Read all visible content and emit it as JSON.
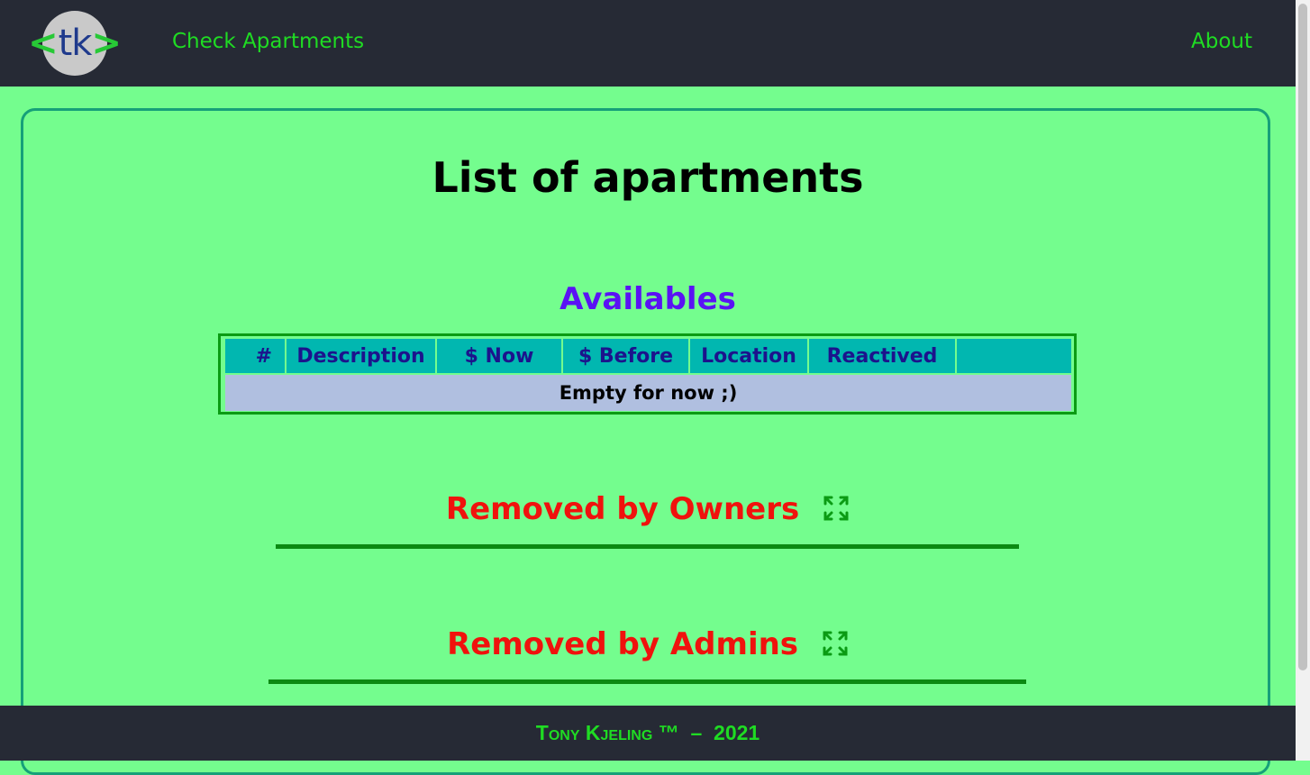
{
  "header": {
    "logo_text_open": "<",
    "logo_text": "tk",
    "logo_text_close": ">",
    "nav_check": "Check Apartments",
    "nav_about": "About"
  },
  "main": {
    "title": "List of apartments",
    "availables": {
      "title": "Availables",
      "columns": [
        "#",
        "Description",
        "$ Now",
        "$ Before",
        "Location",
        "Reactived",
        ""
      ],
      "empty_message": "Empty for now ;)"
    },
    "removed_owners": {
      "title": "Removed by Owners",
      "icon": "expand-icon"
    },
    "removed_admins": {
      "title": "Removed by Admins",
      "icon": "expand-icon"
    }
  },
  "footer": {
    "author": "Tony Kjeling",
    "trademark": "™",
    "separator": "–",
    "year": "2021"
  },
  "colors": {
    "page_bg": "#74fd8e",
    "header_bg": "#262a35",
    "nav_link": "#1fdc23",
    "availables_title": "#5a12f4",
    "removed_title": "#f0120d",
    "table_header_bg": "#01b7b0",
    "table_header_text": "#1c138c",
    "empty_row_bg": "#b0bfe0"
  }
}
